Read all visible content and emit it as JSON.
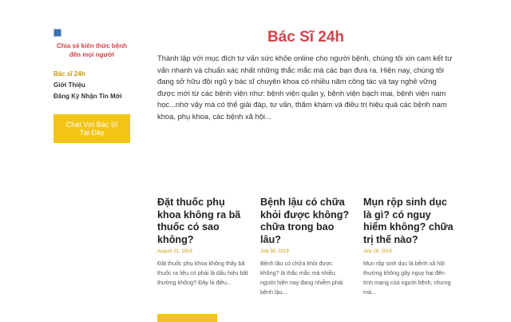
{
  "sidebar": {
    "logo_icon": "image-icon",
    "tagline": "Chia sẻ kiến thức bệnh đến mọi người",
    "menu": [
      {
        "label": "Bác sĩ 24h",
        "active": true
      },
      {
        "label": "Giới Thiệu",
        "active": false
      },
      {
        "label": "Đăng Ký Nhận Tin Mới",
        "active": false
      }
    ],
    "cta_label": "Chát Với Bác Sĩ Tại Đây"
  },
  "main": {
    "title": "Bác Sĩ 24h",
    "intro": "Thành lập với mục đích tư vấn sức khỏe online cho người bệnh, chúng tôi xin cam kết tư vấn nhanh và chuẩn xác nhất những thắc mắc mà các bạn đưa ra. Hiện nay, chúng tôi đang sở hữu đội ngũ y bác sĩ chuyên khoa có nhiều năm công tác và tay nghề vững được mời từ các bệnh viện như: bệnh viện quân y, bệnh viện bạch mai, bệnh viện nam học...nhờ vậy mà có thể giải đáp, tư vấn, thăm khám và điều trị hiệu quả các bệnh nam khoa, phụ khoa, các bệnh xã hội..."
  },
  "posts": [
    {
      "title": "Đặt thuốc phụ khoa không ra bã thuốc có sao không?",
      "date": "August 21, 2019",
      "excerpt": "Đặt thuốc phụ khoa không thấy bã thuốc ra liệu có phải là dấu hiệu bất thường không? Đây là điều..."
    },
    {
      "title": "Bệnh lậu có chữa khỏi được không? chữa trong bao lâu?",
      "date": "July 30, 2019",
      "excerpt": "Bệnh lậu có chữa khỏi được không? là thắc mắc mà nhiều người hiện nay đang nhiễm phải bệnh lậu..."
    },
    {
      "title": "Mụn rộp sinh dục là gì? có nguy hiểm không? chữa trị thế nào?",
      "date": "July 29, 2019",
      "excerpt": "Mụn rộp sinh dục là bệnh xã hội thường không gây nguy hại đến tính mạng của người bệnh, nhưng mà..."
    }
  ],
  "colors": {
    "accent_red": "#d0454c",
    "accent_yellow": "#f2c416"
  }
}
